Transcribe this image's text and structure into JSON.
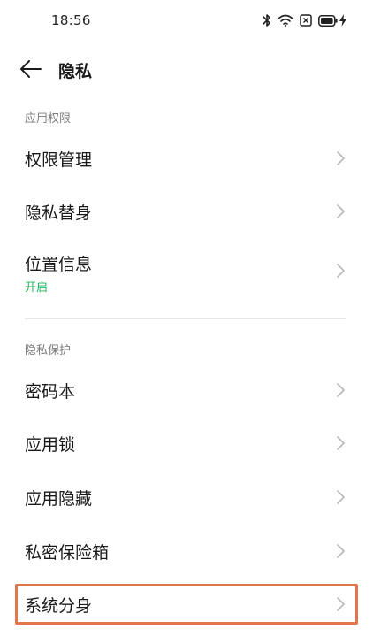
{
  "status_bar": {
    "time": "18:56",
    "icons": [
      "bluetooth-icon",
      "wifi-icon",
      "sim-icon",
      "battery-icon",
      "charging-icon"
    ]
  },
  "header": {
    "title": "隐私"
  },
  "sections": [
    {
      "title": "应用权限",
      "items": [
        {
          "label": "权限管理"
        },
        {
          "label": "隐私替身"
        },
        {
          "label": "位置信息",
          "subtitle": "开启"
        }
      ]
    },
    {
      "title": "隐私保护",
      "items": [
        {
          "label": "密码本"
        },
        {
          "label": "应用锁"
        },
        {
          "label": "应用隐藏"
        },
        {
          "label": "私密保险箱"
        },
        {
          "label": "系统分身"
        }
      ]
    }
  ],
  "colors": {
    "accent_green": "#22b35e",
    "highlight_orange": "#e3754a"
  }
}
